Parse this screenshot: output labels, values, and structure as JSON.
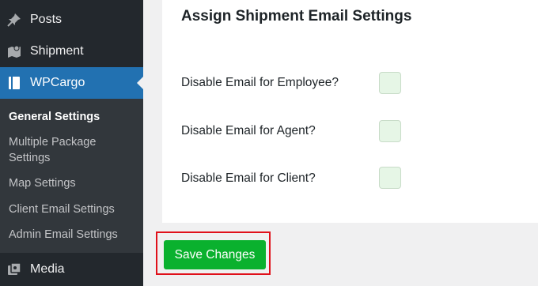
{
  "sidebar": {
    "menu": [
      {
        "label": "Posts",
        "icon": "pushpin-icon"
      },
      {
        "label": "Shipment",
        "icon": "map-icon"
      },
      {
        "label": "WPCargo",
        "icon": "book-icon",
        "active": true
      },
      {
        "label": "Media",
        "icon": "media-icon"
      }
    ],
    "submenu": [
      {
        "label": "General Settings",
        "current": true
      },
      {
        "label": "Multiple Package Settings"
      },
      {
        "label": "Map Settings"
      },
      {
        "label": "Client Email Settings"
      },
      {
        "label": "Admin Email Settings"
      }
    ],
    "colors": {
      "background": "#23282d",
      "active": "#2271b1",
      "submenu": "#32373c"
    }
  },
  "settings": {
    "title": "Assign Shipment Email Settings",
    "rows": [
      {
        "label": "Disable Email for Employee?",
        "checked": false
      },
      {
        "label": "Disable Email for Agent?",
        "checked": false
      },
      {
        "label": "Disable Email for Client?",
        "checked": false
      }
    ]
  },
  "actions": {
    "save_label": "Save Changes",
    "save_color": "#0ab12e",
    "highlight_color": "#e0101a"
  }
}
